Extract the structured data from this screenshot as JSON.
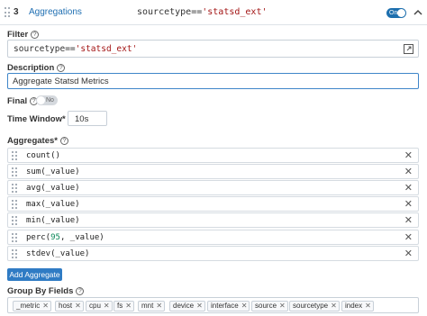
{
  "header": {
    "index": "3",
    "function_name": "Aggregations",
    "filter_prefix": "sourcetype==",
    "filter_string": "'statsd_ext'",
    "enabled_label": "On"
  },
  "filter": {
    "label": "Filter",
    "value_prefix": "sourcetype==",
    "value_string": "'statsd_ext'"
  },
  "description": {
    "label": "Description",
    "value": "Aggregate Statsd Metrics"
  },
  "final": {
    "label": "Final",
    "toggle_label": "No"
  },
  "time_window": {
    "label": "Time Window*",
    "value": "10s"
  },
  "aggregates": {
    "label": "Aggregates*",
    "items": [
      {
        "expr": "count()"
      },
      {
        "expr": "sum(_value)"
      },
      {
        "expr": "avg(_value)"
      },
      {
        "expr": "max(_value)"
      },
      {
        "expr": "min(_value)"
      },
      {
        "expr_pre": "perc(",
        "expr_num": "95",
        "expr_post": ", _value)"
      },
      {
        "expr": "stdev(_value)"
      }
    ],
    "add_label": "Add Aggregate"
  },
  "group_by": {
    "label": "Group By Fields",
    "fields": [
      "_metric",
      "host",
      "cpu",
      "fs",
      "mnt",
      "device",
      "interface",
      "source",
      "sourcetype",
      "index"
    ]
  },
  "colors": {
    "accent": "#2f7bc4",
    "link": "#1f6fb2",
    "string": "#a31515",
    "number": "#098658"
  }
}
